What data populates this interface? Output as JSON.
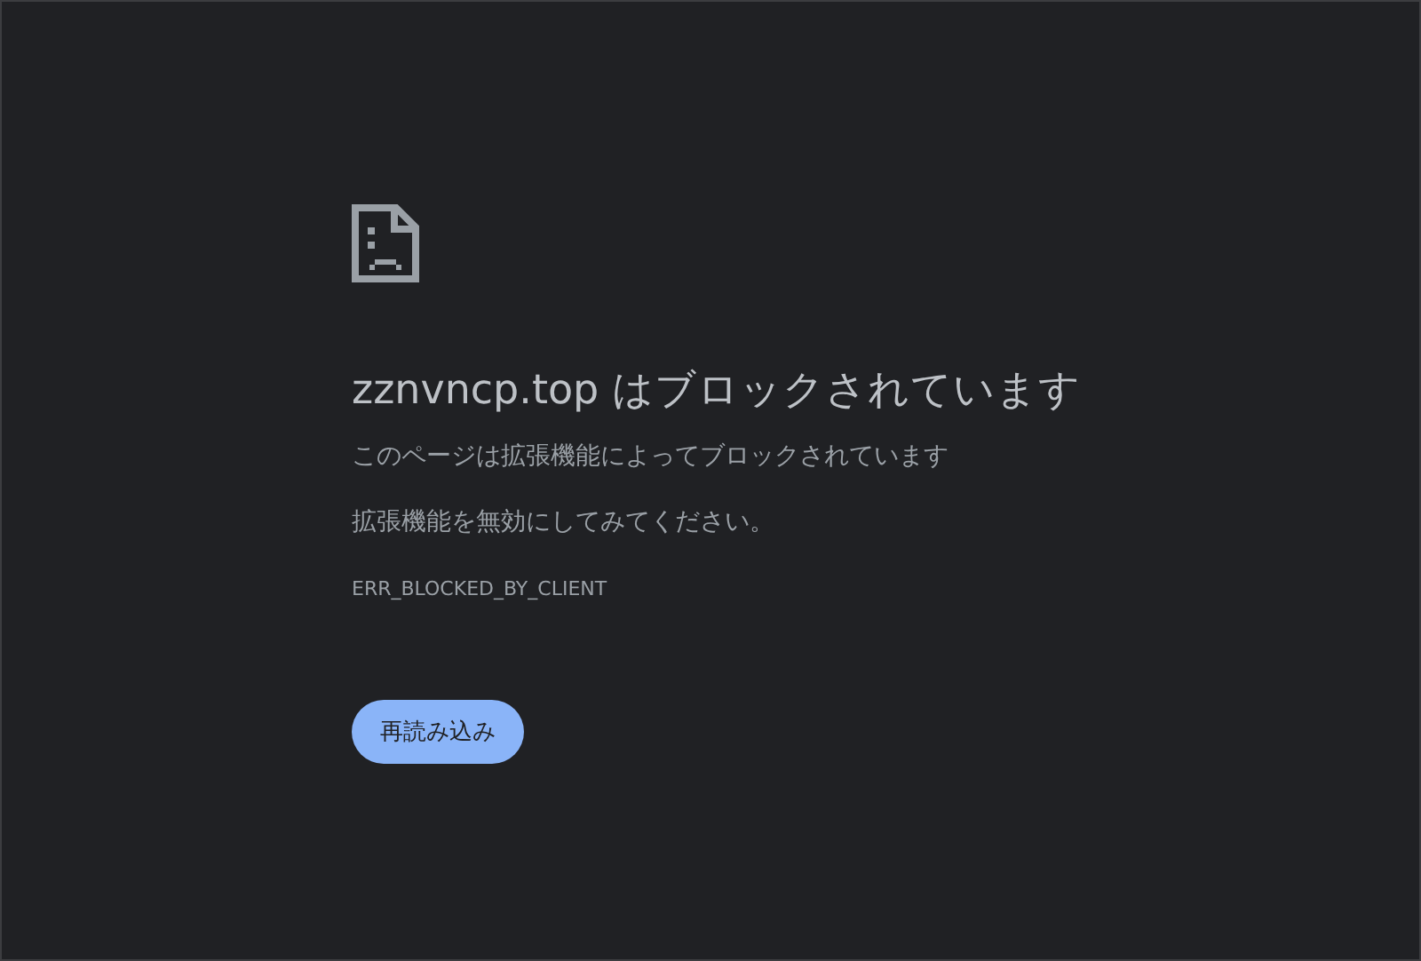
{
  "heading": "zznvncp.top はブロックされています",
  "message": "このページは拡張機能によってブロックされています",
  "suggestion": "拡張機能を無効にしてみてください。",
  "error_code": "ERR_BLOCKED_BY_CLIENT",
  "reload_button": "再読み込み"
}
